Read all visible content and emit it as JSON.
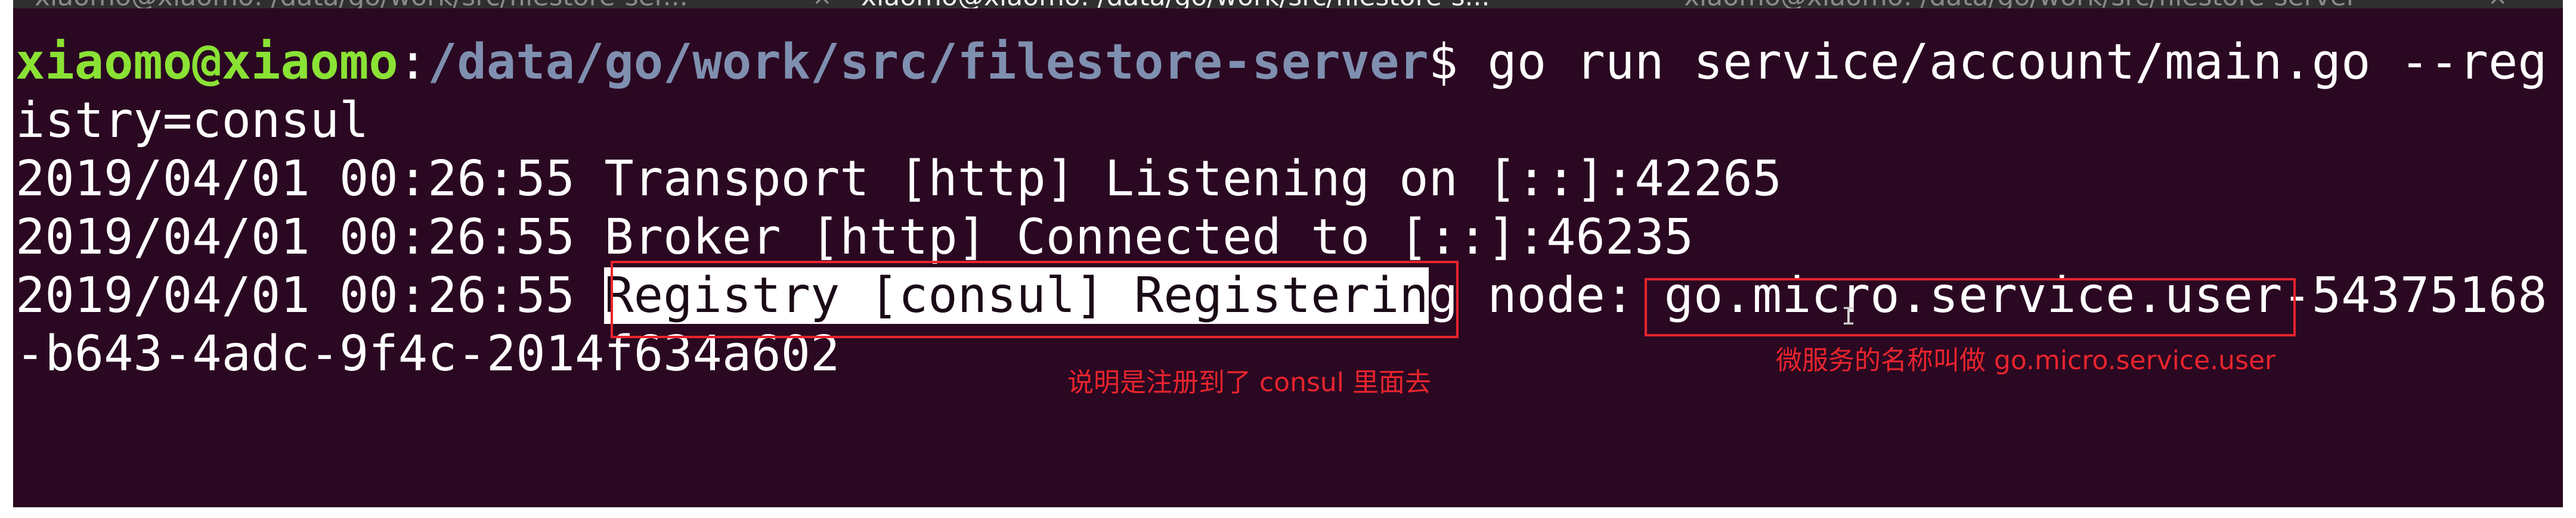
{
  "tabs": [
    {
      "label": "xiaomo@xiaomo: /data/go/work/src/filestore-ser...",
      "active": false
    },
    {
      "label": "xiaomo@xiaomo: /data/go/work/src/filestore-s...",
      "active": true
    },
    {
      "label": "xiaomo@xiaomo: /data/go/work/src/filestore-server",
      "active": false
    }
  ],
  "close_glyph": "×",
  "prompt": {
    "user": "xiaomo@xiaomo",
    "colon": ":",
    "path": "/data/go/work/src/filestore-server",
    "symbol": "$",
    "command": " go run service/account/main.go --reg",
    "command_wrap": "istry=consul"
  },
  "log": {
    "line1": "2019/04/01 00:26:55 Transport [http] Listening on [::]:42265",
    "line2": "2019/04/01 00:26:55 Broker [http] Connected to [::]:46235",
    "line3_prefix": "2019/04/01 00:26:55 ",
    "line3_highlight": "Registry [consul] Registerin",
    "line3_rest": "g node: go.micro.service.user-54375168",
    "line4": "-b643-4adc-9f4c-2014f634a602"
  },
  "annotations": {
    "registry_note": "说明是注册到了 consul 里面去",
    "service_note": "微服务的名称叫做 go.micro.service.user"
  },
  "cursor_glyph": "I",
  "colors": {
    "background": "#2b0822",
    "prompt_user": "#8ae234",
    "prompt_path": "#7f8fb0",
    "annotation_red": "#e8242d"
  }
}
